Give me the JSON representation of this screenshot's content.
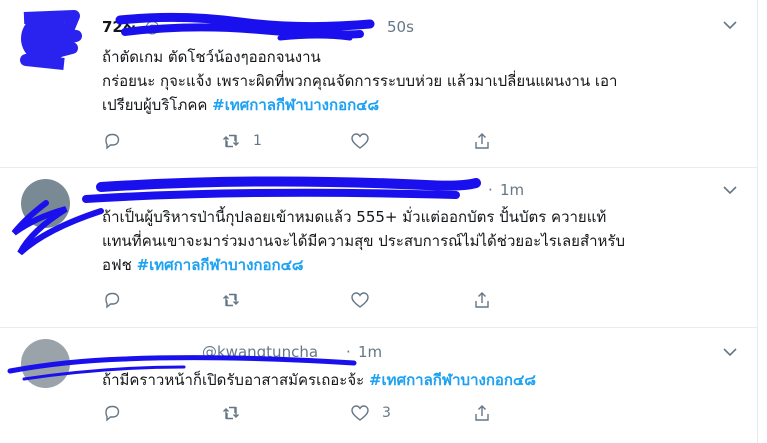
{
  "tweets": [
    {
      "name": "72&",
      "handle": "@",
      "time": "50s",
      "lines": [
        {
          "text": "ถ้าตัดเกม ตัดโชว์น้องๆออกจนงาน",
          "hashtag": ""
        },
        {
          "text": "กร่อยนะ กุจะแจ้ง เพราะผิดที่พวกคุณจัดการระบบห่วย แล้วมาเปลี่ยนแผนงาน เอา",
          "hashtag": ""
        },
        {
          "text": "เปรียบผู้บริโภคค ",
          "hashtag": "#เทศกาลกีฬาบางกอก๔๘"
        }
      ],
      "counts": {
        "reply": "",
        "retweet": "1",
        "like": ""
      }
    },
    {
      "name": "",
      "handle": "",
      "time": "1m",
      "lines": [
        {
          "text": "ถ้าเป็นผู้บริหารป่านี้กุปลอยเข้าหมดแล้ว 555+ มั่วแต่ออกบัตร ปั้นบัตร ควายแท้",
          "hashtag": ""
        },
        {
          "text": "แทนที่คนเขาจะมาร่วมงานจะได้มีความสุข ประสบการณ์ไม่ได้ช่วยอะไรเลยสำหรับ",
          "hashtag": ""
        },
        {
          "text": "อฟช ",
          "hashtag": "#เทศกาลกีฬาบางกอก๔๘"
        }
      ],
      "counts": {
        "reply": "",
        "retweet": "",
        "like": ""
      }
    },
    {
      "name": "",
      "handle": "@kwangtuncha",
      "time": "1m",
      "lines": [
        {
          "text": "ถ้ามีคราวหน้าก็เปิดรับอาสาสมัครเถอะจ้ะ  ",
          "hashtag": "#เทศกาลกีฬาบางกอก๔๘"
        }
      ],
      "counts": {
        "reply": "",
        "retweet": "",
        "like": "3"
      }
    }
  ],
  "colors": {
    "hashtag": "#1da1f2",
    "secondary_text": "#657786",
    "divider": "#e6ecf0",
    "redaction": "#1a10ee"
  },
  "icons": {
    "reply": "reply-icon",
    "retweet": "retweet-icon",
    "like": "heart-icon",
    "share": "share-icon",
    "menu": "chevron-down-icon"
  }
}
